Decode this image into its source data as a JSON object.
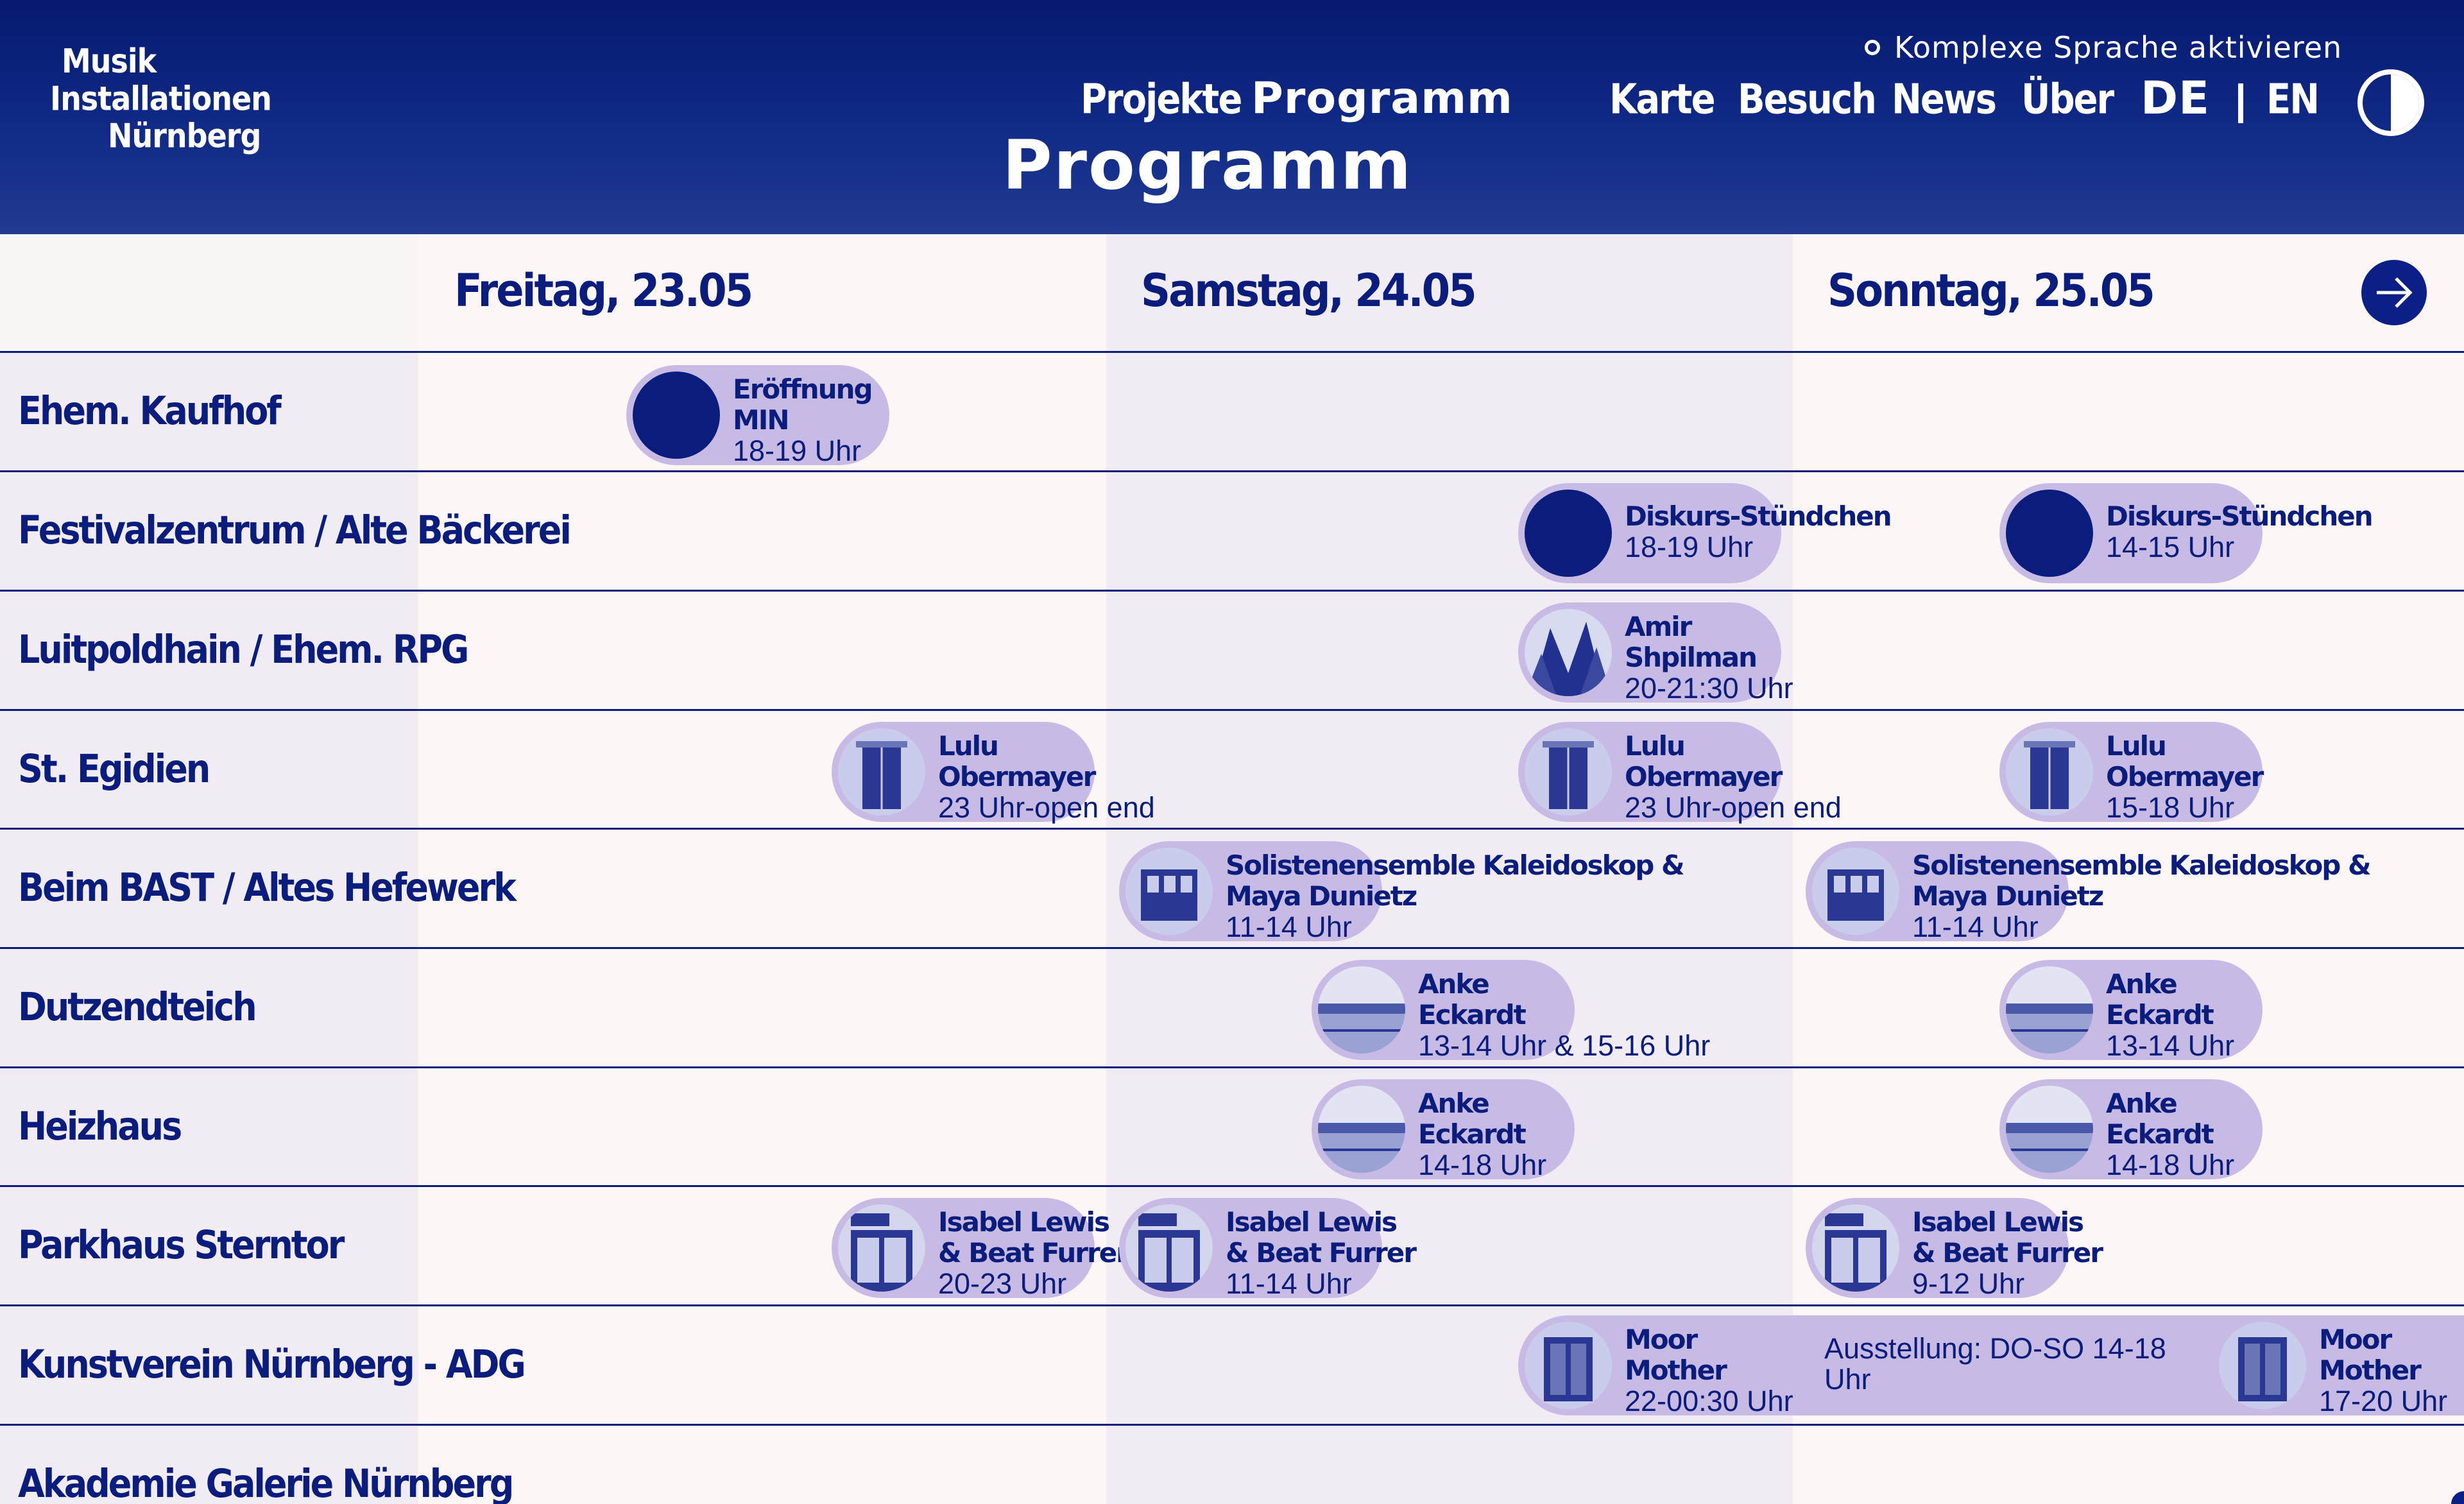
{
  "header": {
    "logo": {
      "line1": "Musik",
      "line2": "Installationen",
      "line3": "Nürnberg"
    },
    "a11y_toggle": "Komplexe Sprache aktivieren",
    "nav": [
      "Projekte",
      "Programm",
      "Karte",
      "Besuch",
      "News",
      "Über"
    ],
    "active_nav": "Programm",
    "lang": {
      "de": "DE",
      "en": "EN",
      "active": "DE"
    },
    "contrast_icon": "half-circle-contrast-icon"
  },
  "page_title": "Programm",
  "days": [
    "Freitag, 23.05",
    "Samstag, 24.05",
    "Sonntag, 25.05"
  ],
  "next_icon": "arrow-right-icon",
  "venues": [
    "Ehem. Kaufhof",
    "Festivalzentrum / Alte Bäckerei",
    "Luitpoldhain / Ehem. RPG",
    "St. Egidien",
    "Beim BAST / Altes Hefewerk",
    "Dutzendteich",
    "Heizhaus",
    "Parkhaus Sterntor",
    "Kunstverein Nürnberg - ADG",
    "Akademie Galerie Nürnberg"
  ],
  "events": {
    "kaufhof_fri": {
      "title1": "Eröffnung",
      "title2": "MIN",
      "time": "18-19 Uhr"
    },
    "festival_sat": {
      "title1": "Diskurs-Stündchen",
      "title2": "",
      "time": "18-19 Uhr"
    },
    "festival_sun": {
      "title1": "Diskurs-Stündchen",
      "title2": "",
      "time": "14-15 Uhr"
    },
    "luitpold_sat": {
      "title1": "Amir",
      "title2": "Shpilman",
      "time": "20-21:30 Uhr"
    },
    "egidien_fri": {
      "title1": "Lulu",
      "title2": "Obermayer",
      "time": "23 Uhr-open end"
    },
    "egidien_sat": {
      "title1": "Lulu",
      "title2": "Obermayer",
      "time": "23 Uhr-open end"
    },
    "egidien_sun": {
      "title1": "Lulu",
      "title2": "Obermayer",
      "time": "15-18 Uhr"
    },
    "bast_sat": {
      "title1": "Solistenensemble Kaleidoskop &",
      "title2": "Maya Dunietz",
      "time": "11-14 Uhr"
    },
    "bast_sun": {
      "title1": "Solistenensemble Kaleidoskop &",
      "title2": "Maya Dunietz",
      "time": "11-14 Uhr"
    },
    "dutzend_sat": {
      "title1": "Anke",
      "title2": "Eckardt",
      "time": "13-14 Uhr & 15-16 Uhr"
    },
    "dutzend_sun": {
      "title1": "Anke",
      "title2": "Eckardt",
      "time": "13-14 Uhr"
    },
    "heiz_sat": {
      "title1": "Anke",
      "title2": "Eckardt",
      "time": "14-18 Uhr"
    },
    "heiz_sun": {
      "title1": "Anke",
      "title2": "Eckardt",
      "time": "14-18 Uhr"
    },
    "park_fri": {
      "title1": "Isabel Lewis",
      "title2": "& Beat Furrer",
      "time": "20-23 Uhr"
    },
    "park_sat": {
      "title1": "Isabel Lewis",
      "title2": "& Beat Furrer",
      "time": "11-14 Uhr"
    },
    "park_sun": {
      "title1": "Isabel Lewis",
      "title2": "& Beat Furrer",
      "time": "9-12 Uhr"
    },
    "kunst_sat": {
      "title1": "Moor",
      "title2": "Mother",
      "time": "22-00:30 Uhr"
    },
    "kunst_sun": {
      "title1": "Moor",
      "title2": "Mother",
      "time": "17-20 Uhr"
    }
  },
  "exhibition": "Ausstellung: DO-SO 14-18 Uhr",
  "colors": {
    "header_bg": "#0d2380",
    "text_primary": "#0a1c7c",
    "pill": "#c7bbe6",
    "column_alt": "#f1ecf4",
    "column_light": "#fcf7f6"
  }
}
